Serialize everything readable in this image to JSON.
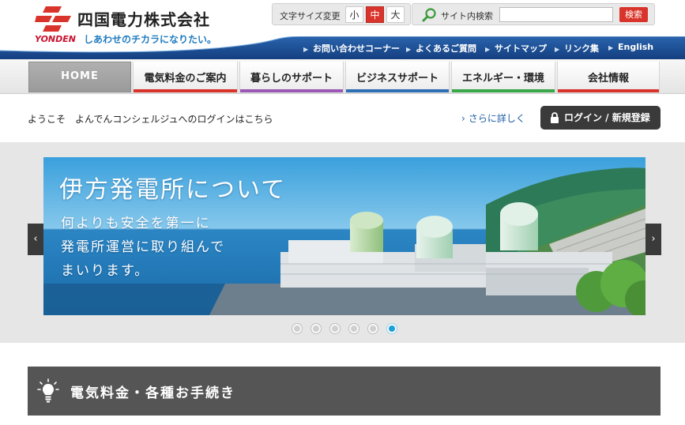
{
  "header": {
    "company_name": "四国電力株式会社",
    "logo_en": "YONDEN",
    "tagline": "しあわせのチカラになりたい。",
    "font_size": {
      "label": "文字サイズ変更",
      "small": "小",
      "medium": "中",
      "large": "大",
      "selected": "中"
    },
    "search": {
      "label": "サイト内検索",
      "value": "",
      "placeholder": "",
      "button": "検索"
    },
    "utility_links": [
      "お問い合わせコーナー",
      "よくあるご質問",
      "サイトマップ",
      "リンク集",
      "English"
    ]
  },
  "nav": {
    "items": [
      {
        "label": "HOME",
        "color": "#999999"
      },
      {
        "label": "電気料金のご案内",
        "color": "#d9342b"
      },
      {
        "label": "暮らしのサポート",
        "color": "#9b59b6"
      },
      {
        "label": "ビジネスサポート",
        "color": "#2f6fb5"
      },
      {
        "label": "エネルギー・環境",
        "color": "#3aa84a"
      },
      {
        "label": "会社情報",
        "color": "#d9342b"
      }
    ]
  },
  "welcome": {
    "message": "ようこそ　よんでんコンシェルジュへのログインはこちら",
    "more_link": "さらに詳しく",
    "login_button": "ログイン / 新規登録"
  },
  "carousel": {
    "title": "伊方発電所について",
    "lines": [
      "何よりも安全を第一に",
      "発電所運営に取り組んで",
      "まいります。"
    ],
    "prev": "‹",
    "next": "›",
    "slide_count": 6,
    "active_index": 5
  },
  "section": {
    "title": "電気料金・各種お手続き",
    "icon": "lightbulb-icon"
  },
  "colors": {
    "brand_red": "#d9342b",
    "brand_blue": "#1f4f96",
    "dot_active": "#1aa1d8"
  }
}
